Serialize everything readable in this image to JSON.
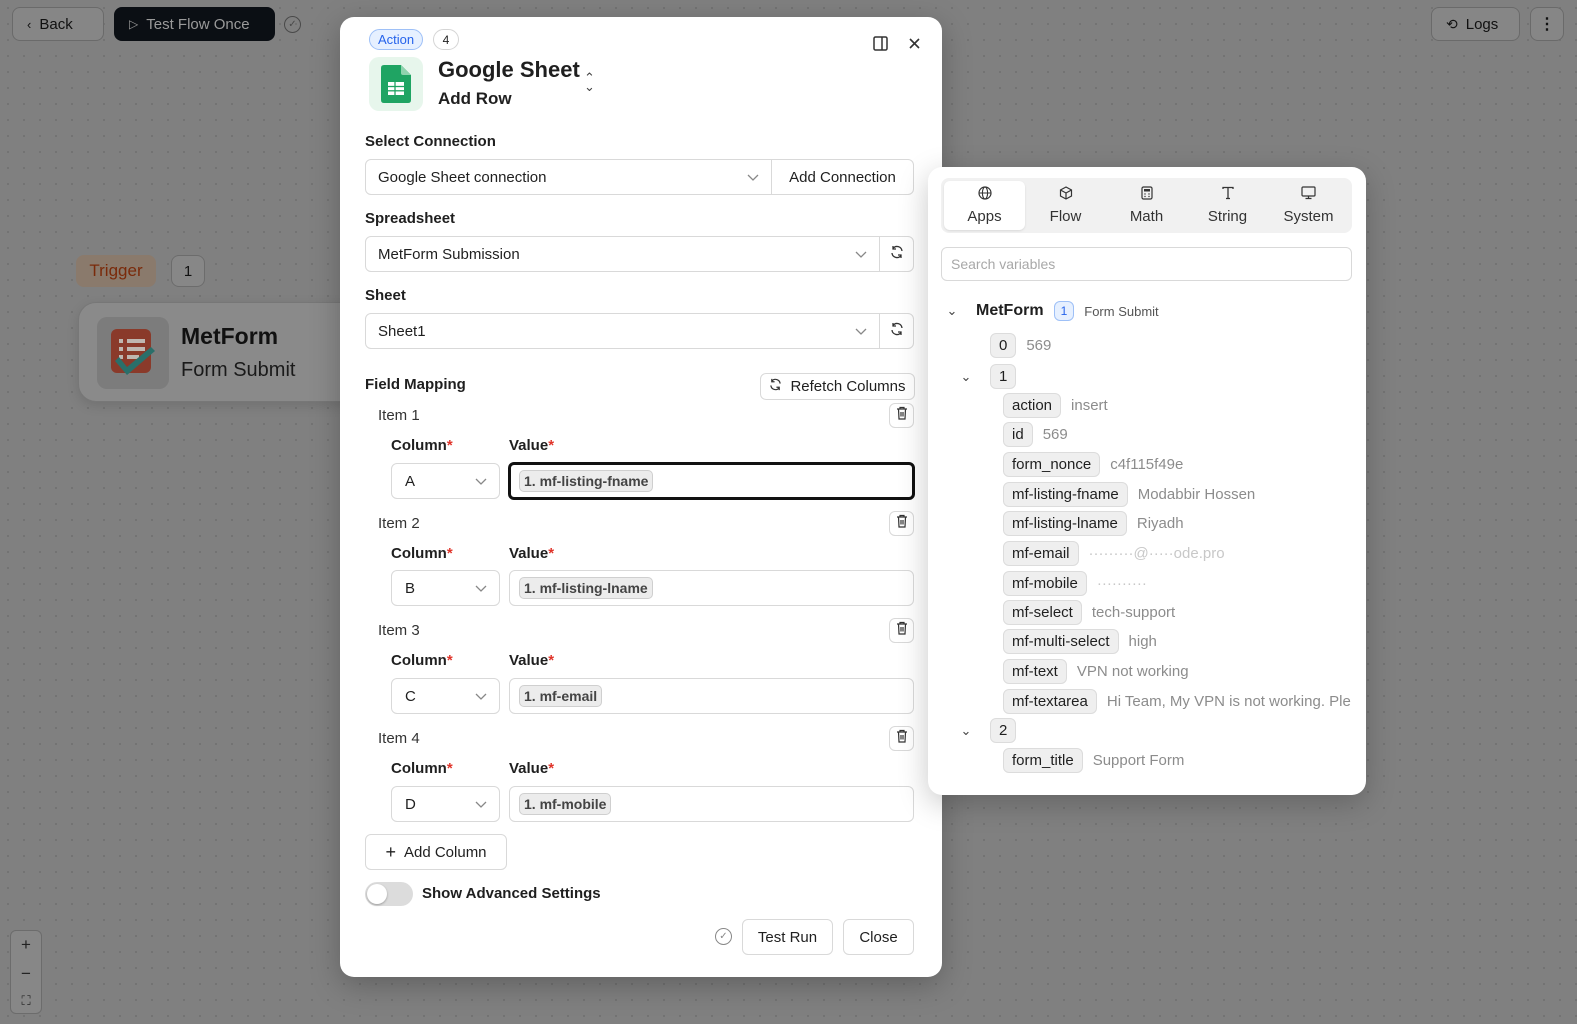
{
  "toolbar": {
    "back_label": "Back",
    "test_flow_label": "Test Flow Once",
    "logs_label": "Logs"
  },
  "trigger": {
    "tag": "Trigger",
    "count": "1",
    "node_title": "MetForm",
    "node_subtitle": "Form Submit"
  },
  "modal": {
    "badge": "Action",
    "step": "4",
    "app_title": "Google Sheet",
    "app_action": "Add Row",
    "select_connection_label": "Select Connection",
    "connection_value": "Google Sheet connection",
    "add_connection_label": "Add Connection",
    "spreadsheet_label": "Spreadsheet",
    "spreadsheet_value": "MetForm Submission",
    "sheet_label": "Sheet",
    "sheet_value": "Sheet1",
    "field_mapping_label": "Field Mapping",
    "refetch_label": "Refetch Columns",
    "column_label": "Column",
    "value_label": "Value",
    "required_mark": "*",
    "items": [
      {
        "label": "Item 1",
        "column": "A",
        "value": "1. mf-listing-fname"
      },
      {
        "label": "Item 2",
        "column": "B",
        "value": "1. mf-listing-lname"
      },
      {
        "label": "Item 3",
        "column": "C",
        "value": "1. mf-email"
      },
      {
        "label": "Item 4",
        "column": "D",
        "value": "1. mf-mobile"
      }
    ],
    "add_column_label": "Add Column",
    "advanced_label": "Show Advanced Settings",
    "test_run_label": "Test Run",
    "close_label": "Close"
  },
  "variables": {
    "tabs": [
      {
        "label": "Apps",
        "icon": "globe-icon"
      },
      {
        "label": "Flow",
        "icon": "cube-icon"
      },
      {
        "label": "Math",
        "icon": "calculator-icon"
      },
      {
        "label": "String",
        "icon": "type-icon"
      },
      {
        "label": "System",
        "icon": "monitor-icon"
      }
    ],
    "search_placeholder": "Search variables",
    "root_name": "MetForm",
    "root_badge": "1",
    "root_event": "Form Submit",
    "node_0_key": "0",
    "node_0_value": "569",
    "node_1_key": "1",
    "fields": [
      {
        "key": "action",
        "value": "insert"
      },
      {
        "key": "id",
        "value": "569"
      },
      {
        "key": "form_nonce",
        "value": "c4f115f49e"
      },
      {
        "key": "mf-listing-fname",
        "value": "Modabbir Hossen"
      },
      {
        "key": "mf-listing-lname",
        "value": "Riyadh"
      },
      {
        "key": "mf-email",
        "value": "·········@·····ode.pro"
      },
      {
        "key": "mf-mobile",
        "value": "··········"
      },
      {
        "key": "mf-select",
        "value": "tech-support"
      },
      {
        "key": "mf-multi-select",
        "value": "high"
      },
      {
        "key": "mf-text",
        "value": "VPN not working"
      },
      {
        "key": "mf-textarea",
        "value": "Hi Team, My VPN is not working. Ple"
      }
    ],
    "node_2_key": "2",
    "node_2_fields": [
      {
        "key": "form_title",
        "value": "Support Form"
      }
    ]
  }
}
